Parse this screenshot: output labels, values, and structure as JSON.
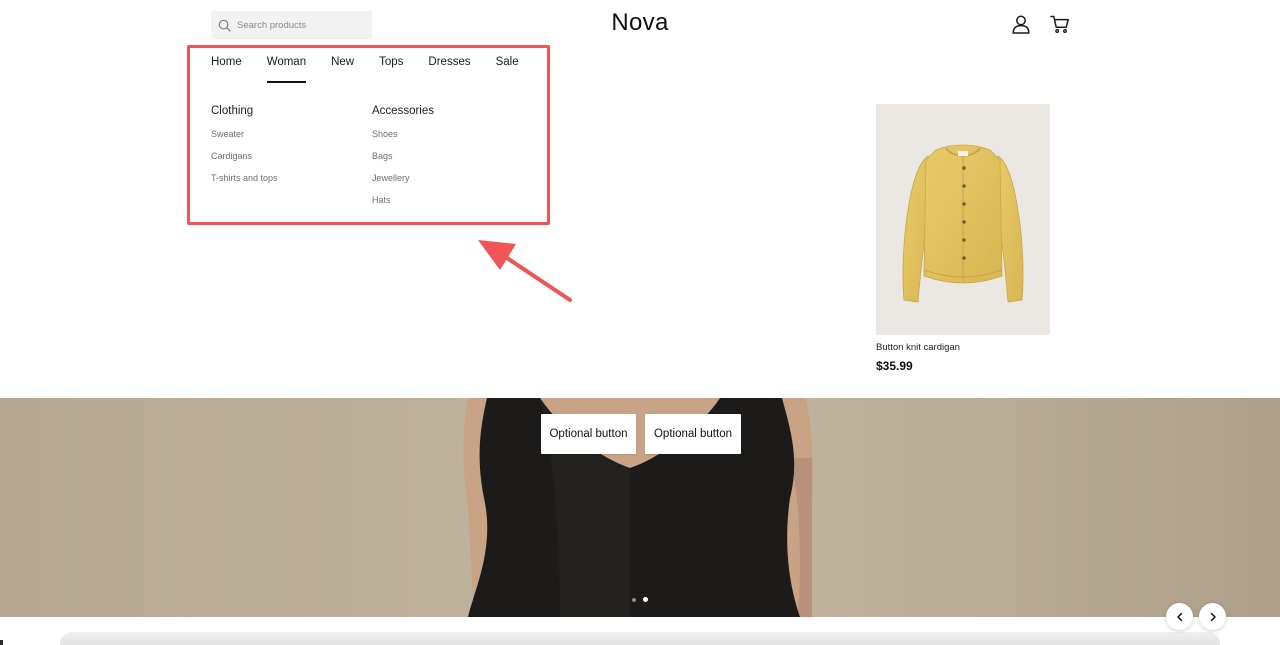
{
  "header": {
    "search_placeholder": "Search products",
    "logo": "Nova",
    "icons": [
      "search-icon",
      "user-icon",
      "cart-icon"
    ]
  },
  "nav": {
    "items": [
      {
        "label": "Home"
      },
      {
        "label": "Woman"
      },
      {
        "label": "New"
      },
      {
        "label": "Tops"
      },
      {
        "label": "Dresses"
      },
      {
        "label": "Sale"
      }
    ],
    "active_item": "Woman"
  },
  "mega_menu": {
    "clothing": {
      "title": "Clothing",
      "links": [
        "Sweater",
        "Cardigans",
        "T-shirts and tops"
      ]
    },
    "accessories": {
      "title": "Accessories",
      "links": [
        "Shoes",
        "Bags",
        "Jewellery",
        "Hats"
      ]
    }
  },
  "featured_product": {
    "name": "Button knit cardigan",
    "price": "$35.99",
    "image_icon": "yellow-cardigan-image"
  },
  "hero": {
    "buttons": [
      {
        "label": "Optional button"
      },
      {
        "label": "Optional button"
      }
    ],
    "slide_count": 2,
    "active_slide": 2
  },
  "annotation": {
    "highlight_color": "#f05454"
  },
  "colors": {
    "text": "#1a1a1a",
    "search_bg": "#f2f2f2",
    "product_bg": "#ebe7e2",
    "hero_bg": "#bdb09b",
    "annotation": "#f05454"
  }
}
